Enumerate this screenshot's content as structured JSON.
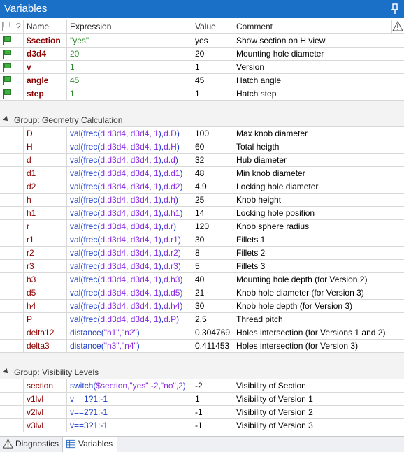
{
  "window": {
    "title": "Variables"
  },
  "columns": {
    "q": "?",
    "name": "Name",
    "expression": "Expression",
    "value": "Value",
    "comment": "Comment"
  },
  "top_rows": [
    {
      "name": "$section",
      "expression": "\"yes\"",
      "value": "yes",
      "comment": "Show section on H view",
      "dropdown": true
    },
    {
      "name": "d3d4",
      "expression": "20",
      "value": "20",
      "comment": "Mounting hole diameter",
      "dropdown": true
    },
    {
      "name": "v",
      "expression": "1",
      "value": "1",
      "comment": "Version",
      "dropdown": true
    },
    {
      "name": "angle",
      "expression": "45",
      "value": "45",
      "comment": "Hatch angle",
      "dropdown": false
    },
    {
      "name": "step",
      "expression": "1",
      "value": "1",
      "comment": "Hatch step",
      "dropdown": false
    }
  ],
  "groups": [
    {
      "label": "Group: Geometry Calculation",
      "rows": [
        {
          "name": "D",
          "fn": "val",
          "frec": "frec",
          "args": "d.d3d4, d3d4, 1",
          "tail": "d.D",
          "value": "100",
          "comment": "Max knob diameter"
        },
        {
          "name": "H",
          "fn": "val",
          "frec": "frec",
          "args": "d.d3d4, d3d4, 1",
          "tail": "d.H",
          "value": "60",
          "comment": "Total heigth"
        },
        {
          "name": "d",
          "fn": "val",
          "frec": "frec",
          "args": "d.d3d4, d3d4, 1",
          "tail": "d.d",
          "value": "32",
          "comment": "Hub diameter"
        },
        {
          "name": "d1",
          "fn": "val",
          "frec": "frec",
          "args": "d.d3d4, d3d4, 1",
          "tail": "d.d1",
          "value": "48",
          "comment": "Min knob diameter"
        },
        {
          "name": "d2",
          "fn": "val",
          "frec": "frec",
          "args": "d.d3d4, d3d4, 1",
          "tail": "d.d2",
          "value": "4.9",
          "comment": "Locking hole diameter"
        },
        {
          "name": "h",
          "fn": "val",
          "frec": "frec",
          "args": "d.d3d4, d3d4, 1",
          "tail": "d.h",
          "value": "25",
          "comment": "Knob height"
        },
        {
          "name": "h1",
          "fn": "val",
          "frec": "frec",
          "args": "d.d3d4, d3d4, 1",
          "tail": "d.h1",
          "value": "14",
          "comment": "Locking hole position"
        },
        {
          "name": "r",
          "fn": "val",
          "frec": "frec",
          "args": "d.d3d4, d3d4, 1",
          "tail": "d.r",
          "value": "120",
          "comment": "Knob sphere radius"
        },
        {
          "name": "r1",
          "fn": "val",
          "frec": "frec",
          "args": "d.d3d4, d3d4, 1",
          "tail": "d.r1",
          "value": "30",
          "comment": "Fillets 1"
        },
        {
          "name": "r2",
          "fn": "val",
          "frec": "frec",
          "args": "d.d3d4, d3d4, 1",
          "tail": "d.r2",
          "value": "8",
          "comment": "Fillets 2"
        },
        {
          "name": "r3",
          "fn": "val",
          "frec": "frec",
          "args": "d.d3d4, d3d4, 1",
          "tail": "d.r3",
          "value": "5",
          "comment": "Fillets 3"
        },
        {
          "name": "h3",
          "fn": "val",
          "frec": "frec",
          "args": "d.d3d4, d3d4, 1",
          "tail": "d.h3",
          "value": "40",
          "comment": "Mounting hole depth (for Version 2)"
        },
        {
          "name": "d5",
          "fn": "val",
          "frec": "frec",
          "args": "d.d3d4, d3d4, 1",
          "tail": "d.d5",
          "value": "21",
          "comment": "Knob hole diameter (for Version 3)"
        },
        {
          "name": "h4",
          "fn": "val",
          "frec": "frec",
          "args": "d.d3d4, d3d4, 1",
          "tail": "d.h4",
          "value": "30",
          "comment": "Knob hole depth (for Version 3)"
        },
        {
          "name": "P",
          "fn": "val",
          "frec": "frec",
          "args": "d.d3d4, d3d4, 1",
          "tail": "d.P",
          "value": "2.5",
          "comment": "Thread pitch"
        },
        {
          "name": "delta12",
          "fn": "distance",
          "frec": "",
          "args": "\"n1\",\"n2\"",
          "tail": "",
          "value": "0.304769",
          "comment": "Holes intersection (for Versions 1 and 2)"
        },
        {
          "name": "delta3",
          "fn": "distance",
          "frec": "",
          "args": "\"n3\",\"n4\"",
          "tail": "",
          "value": "0.411453",
          "comment": "Holes intersection (for Version 3)"
        }
      ]
    },
    {
      "label": "Group: Visibility Levels",
      "rows": [
        {
          "name": "section",
          "fn": "switch",
          "frec": "",
          "args": "$section,\"yes\",-2,\"no\",2",
          "tail": "",
          "value": "-2",
          "comment": "Visibility of Section"
        },
        {
          "name": "v1lvl",
          "fn": "",
          "frec": "",
          "args": "v==1?1:-1",
          "tail": "",
          "value": "1",
          "comment": "Visibility of Version 1"
        },
        {
          "name": "v2lvl",
          "fn": "",
          "frec": "",
          "args": "v==2?1:-1",
          "tail": "",
          "value": "-1",
          "comment": "Visibility of Version 2"
        },
        {
          "name": "v3lvl",
          "fn": "",
          "frec": "",
          "args": "v==3?1:-1",
          "tail": "",
          "value": "-1",
          "comment": "Visibility of Version 3"
        }
      ]
    }
  ],
  "bottom_tabs": [
    {
      "label": "Diagnostics",
      "icon": "warning-icon",
      "active": false
    },
    {
      "label": "Variables",
      "icon": "table-icon",
      "active": true
    }
  ],
  "icons": {
    "pin": "pin-icon",
    "flag": "green-flag-icon",
    "warning": "warning-icon",
    "dropdown": "chevron-down-icon"
  },
  "colors": {
    "titlebar": "#1a6fc6",
    "name_red": "#8b0000",
    "expr_green": "#2a8a2a",
    "fn_blue": "#1a3cc8",
    "arg_purple": "#8a2be2"
  }
}
